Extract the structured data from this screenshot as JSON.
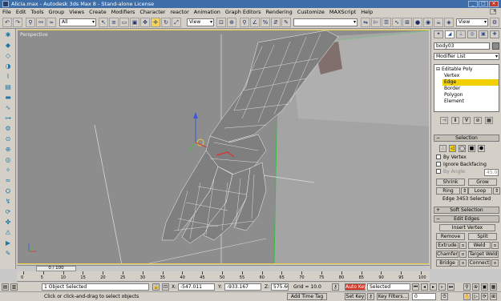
{
  "window": {
    "title": "Alicia.max - Autodesk 3ds Max 8 - Stand-alone License",
    "minimize": "_",
    "maximize": "□",
    "close": "×"
  },
  "menu": [
    "File",
    "Edit",
    "Tools",
    "Group",
    "Views",
    "Create",
    "Modifiers",
    "Character",
    "reactor",
    "Animation",
    "Graph Editors",
    "Rendering",
    "Customize",
    "MAXScript",
    "Help"
  ],
  "toolbar": {
    "selection_filter": "All",
    "ref_coord": "View",
    "named_selection": "",
    "view_right": "View"
  },
  "viewport": {
    "label": "Perspective"
  },
  "command_panel": {
    "object_name": "body03",
    "modifier_list": "Modifier List",
    "stack": {
      "root": "Editable Poly",
      "items": [
        "Vertex",
        "Edge",
        "Border",
        "Polygon",
        "Element"
      ],
      "selected": "Edge"
    },
    "selection": {
      "title": "Selection",
      "by_vertex": "By Vertex",
      "ignore_backfacing": "Ignore Backfacing",
      "by_angle": "By Angle:",
      "angle_value": "45.0",
      "shrink": "Shrink",
      "grow": "Grow",
      "ring": "Ring",
      "loop": "Loop",
      "status": "Edge 3453 Selected"
    },
    "soft_selection": "Soft Selection",
    "edit_edges": {
      "title": "Edit Edges",
      "insert_vertex": "Insert Vertex",
      "remove": "Remove",
      "split": "Split",
      "extrude": "Extrude",
      "weld": "Weld",
      "chamfer": "Chamfer",
      "target_weld": "Target Weld",
      "bridge": "Bridge",
      "connect": "Connect",
      "create_shape": "Create Shape From Selection"
    }
  },
  "timeline": {
    "frame": "0 / 100",
    "ticks": [
      "0",
      "5",
      "10",
      "15",
      "20",
      "25",
      "30",
      "35",
      "40",
      "45",
      "50",
      "55",
      "60",
      "65",
      "70",
      "75",
      "80",
      "85",
      "90",
      "95",
      "100"
    ]
  },
  "status": {
    "selected": "1 Object Selected",
    "prompt": "Click or click-and-drag to select objects",
    "x_label": "X:",
    "x": "-547.011",
    "y_label": "Y:",
    "y": "-933.167",
    "z_label": "Z:",
    "z": "575.606",
    "grid": "Grid = 10.0",
    "add_time_tag": "Add Time Tag",
    "auto_key": "Auto Key",
    "set_key": "Set Key",
    "key_mode": "Selected",
    "key_filters": "Key Filters...",
    "current_frame": "0"
  },
  "colors": {
    "title_bar": "#3d6ea8",
    "viewport_bg": "#8d8d8d",
    "selected_highlight": "#f2d000",
    "auto_key": "#d23a2c"
  }
}
